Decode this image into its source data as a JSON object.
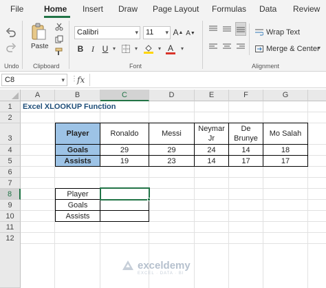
{
  "menu": {
    "tabs": [
      "File",
      "Home",
      "Insert",
      "Draw",
      "Page Layout",
      "Formulas",
      "Data",
      "Review"
    ],
    "active": "Home"
  },
  "ribbon": {
    "groups": {
      "undo": "Undo",
      "clipboard": "Clipboard",
      "font": "Font",
      "alignment": "Alignment"
    },
    "paste_label": "Paste",
    "font_name": "Calibri",
    "font_size": "11",
    "format_buttons": [
      "B",
      "I",
      "U"
    ],
    "wrap_text": "Wrap Text",
    "merge_center": "Merge & Center",
    "accent_color": "#217346",
    "font_color_bar": "#d9342b",
    "fill_color_bar": "#ffd500"
  },
  "formula_bar": {
    "name_box": "C8",
    "fx_label": "fx",
    "formula": ""
  },
  "sheet": {
    "columns": [
      "A",
      "B",
      "C",
      "D",
      "E",
      "F",
      "G"
    ],
    "rows": [
      "1",
      "2",
      "3",
      "4",
      "5",
      "6",
      "7",
      "8",
      "9",
      "10",
      "11",
      "12"
    ],
    "selected_cell": "C8",
    "title": "Excel XLOOKUP Function",
    "data_table": {
      "header_label": "Player",
      "players": [
        "Ronaldo",
        "Messi",
        "Neymar Jr",
        "De Brunye",
        "Mo Salah"
      ],
      "rows": [
        {
          "label": "Goals",
          "values": [
            "29",
            "29",
            "24",
            "14",
            "18"
          ]
        },
        {
          "label": "Assists",
          "values": [
            "19",
            "23",
            "14",
            "17",
            "17"
          ]
        }
      ],
      "header_fill": "#9dc3e6"
    },
    "lookup_table": {
      "labels": [
        "Player",
        "Goals",
        "Assists"
      ],
      "values": [
        "",
        "",
        ""
      ]
    }
  },
  "watermark": {
    "name": "exceldemy",
    "tagline": "EXCEL · DATA · BI"
  }
}
